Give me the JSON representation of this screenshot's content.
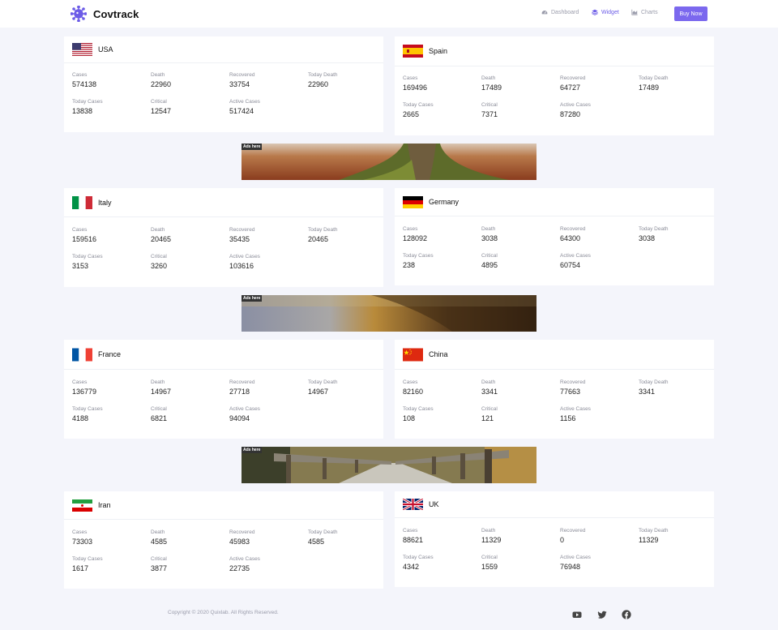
{
  "header": {
    "brand": "Covtrack",
    "nav": {
      "dashboard": "Dashboard",
      "widget": "Widget",
      "charts": "Charts"
    },
    "buy_label": "Buy Now"
  },
  "labels": {
    "cases": "Cases",
    "death": "Death",
    "recovered": "Recovered",
    "today_death": "Today Death",
    "today_cases": "Today Cases",
    "critical": "Critical",
    "active_cases": "Active Cases"
  },
  "countries": {
    "usa": {
      "name": "USA",
      "cases": "574138",
      "death": "22960",
      "recovered": "33754",
      "today_death": "22960",
      "today_cases": "13838",
      "critical": "12547",
      "active_cases": "517424"
    },
    "spain": {
      "name": "Spain",
      "cases": "169496",
      "death": "17489",
      "recovered": "64727",
      "today_death": "17489",
      "today_cases": "2665",
      "critical": "7371",
      "active_cases": "87280"
    },
    "italy": {
      "name": "Italy",
      "cases": "159516",
      "death": "20465",
      "recovered": "35435",
      "today_death": "20465",
      "today_cases": "3153",
      "critical": "3260",
      "active_cases": "103616"
    },
    "germany": {
      "name": "Germany",
      "cases": "128092",
      "death": "3038",
      "recovered": "64300",
      "today_death": "3038",
      "today_cases": "238",
      "critical": "4895",
      "active_cases": "60754"
    },
    "france": {
      "name": "France",
      "cases": "136779",
      "death": "14967",
      "recovered": "27718",
      "today_death": "14967",
      "today_cases": "4188",
      "critical": "6821",
      "active_cases": "94094"
    },
    "china": {
      "name": "China",
      "cases": "82160",
      "death": "3341",
      "recovered": "77663",
      "today_death": "3341",
      "today_cases": "108",
      "critical": "121",
      "active_cases": "1156"
    },
    "iran": {
      "name": "Iran",
      "cases": "73303",
      "death": "4585",
      "recovered": "45983",
      "today_death": "4585",
      "today_cases": "1617",
      "critical": "3877",
      "active_cases": "22735"
    },
    "uk": {
      "name": "UK",
      "cases": "88621",
      "death": "11329",
      "recovered": "0",
      "today_death": "11329",
      "today_cases": "4342",
      "critical": "1559",
      "active_cases": "76948"
    }
  },
  "ads": {
    "tag": "Ads here"
  },
  "footer": {
    "copyright": "Copyright © 2020 Quixlab. All Rights Reserved."
  },
  "colors": {
    "accent": "#7b68ee",
    "background": "#f4f5fb"
  }
}
